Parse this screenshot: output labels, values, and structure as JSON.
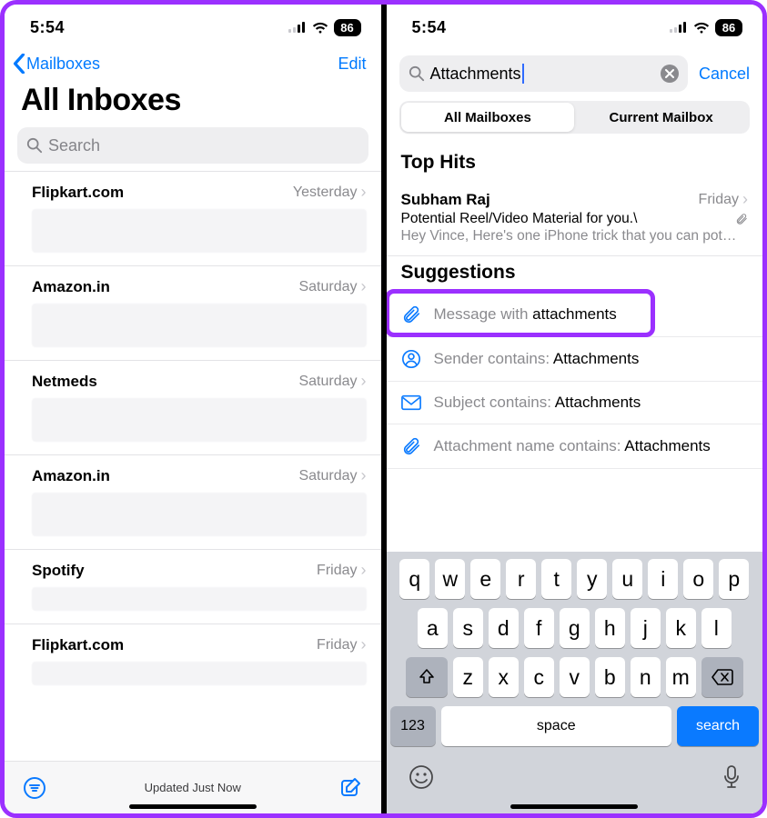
{
  "status": {
    "time": "5:54",
    "battery": "86"
  },
  "left": {
    "back_label": "Mailboxes",
    "edit_label": "Edit",
    "title": "All Inboxes",
    "search_placeholder": "Search",
    "rows": [
      {
        "sender": "Flipkart.com",
        "date": "Yesterday"
      },
      {
        "sender": "Amazon.in",
        "date": "Saturday"
      },
      {
        "sender": "Netmeds",
        "date": "Saturday"
      },
      {
        "sender": "Amazon.in",
        "date": "Saturday"
      },
      {
        "sender": "Spotify",
        "date": "Friday"
      },
      {
        "sender": "Flipkart.com",
        "date": "Friday"
      }
    ],
    "updated": "Updated Just Now"
  },
  "right": {
    "search_value": "Attachments",
    "cancel": "Cancel",
    "seg_all": "All Mailboxes",
    "seg_current": "Current Mailbox",
    "top_hits": "Top Hits",
    "hit": {
      "name": "Subham Raj",
      "date": "Friday",
      "subject": "Potential Reel/Video Material for you.\\",
      "preview": "Hey Vince, Here's one iPhone trick that you can pot…"
    },
    "suggestions_title": "Suggestions",
    "suggestions": [
      {
        "icon": "paperclip",
        "pre": "Message with ",
        "bold": "attachments"
      },
      {
        "icon": "person",
        "pre": "Sender contains: ",
        "bold": "Attachments"
      },
      {
        "icon": "envelope",
        "pre": "Subject contains: ",
        "bold": "Attachments"
      },
      {
        "icon": "paperclip",
        "pre": "Attachment name contains: ",
        "bold": "Attachments"
      }
    ],
    "keyboard": {
      "r1": [
        "q",
        "w",
        "e",
        "r",
        "t",
        "y",
        "u",
        "i",
        "o",
        "p"
      ],
      "r2": [
        "a",
        "s",
        "d",
        "f",
        "g",
        "h",
        "j",
        "k",
        "l"
      ],
      "r3": [
        "z",
        "x",
        "c",
        "v",
        "b",
        "n",
        "m"
      ],
      "num": "123",
      "space": "space",
      "search": "search"
    }
  }
}
